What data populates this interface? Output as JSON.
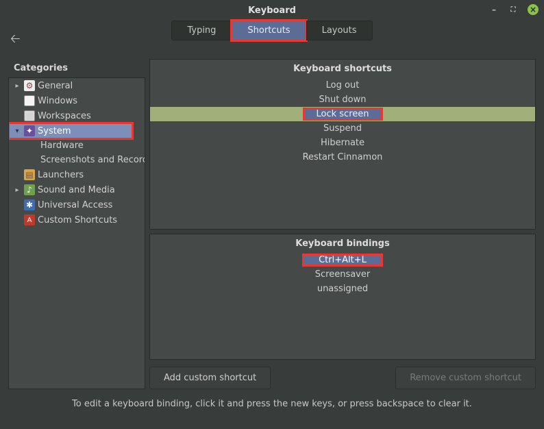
{
  "window": {
    "title": "Keyboard"
  },
  "tabs": {
    "typing": "Typing",
    "shortcuts": "Shortcuts",
    "layouts": "Layouts"
  },
  "sidebar": {
    "title": "Categories",
    "items": [
      {
        "label": "General"
      },
      {
        "label": "Windows"
      },
      {
        "label": "Workspaces"
      },
      {
        "label": "System"
      },
      {
        "label": "Hardware"
      },
      {
        "label": "Screenshots and Recording"
      },
      {
        "label": "Launchers"
      },
      {
        "label": "Sound and Media"
      },
      {
        "label": "Universal Access"
      },
      {
        "label": "Custom Shortcuts"
      }
    ]
  },
  "shortcuts": {
    "title": "Keyboard shortcuts",
    "items": [
      "Log out",
      "Shut down",
      "Lock screen",
      "Suspend",
      "Hibernate",
      "Restart Cinnamon"
    ]
  },
  "bindings": {
    "title": "Keyboard bindings",
    "items": [
      "Ctrl+Alt+L",
      "Screensaver",
      "unassigned"
    ]
  },
  "buttons": {
    "add": "Add custom shortcut",
    "remove": "Remove custom shortcut"
  },
  "hint": "To edit a keyboard binding, click it and press the new keys, or press backspace to clear it."
}
